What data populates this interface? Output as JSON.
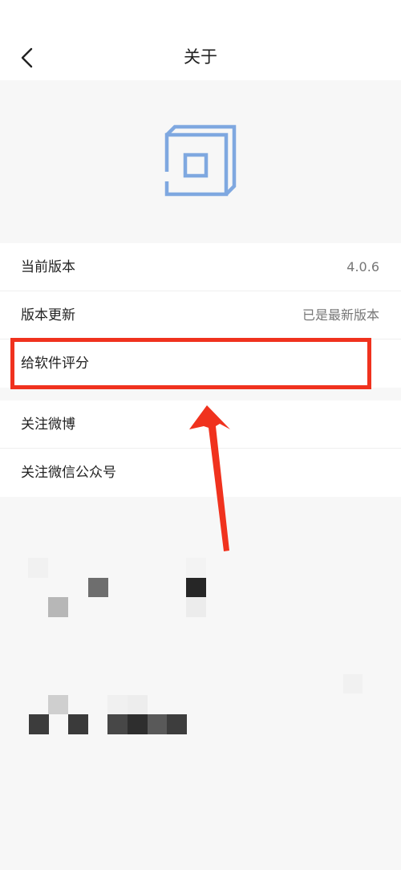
{
  "header": {
    "title": "关于",
    "back_icon": "chevron-left-icon"
  },
  "logo": {
    "icon": "app-logo-icon",
    "color": "#7fa8e0"
  },
  "settings": {
    "rows": [
      {
        "label": "当前版本",
        "value": "4.0.6"
      },
      {
        "label": "版本更新",
        "value": "已是最新版本"
      },
      {
        "label": "给软件评分",
        "value": ""
      },
      {
        "label": "关注微博",
        "value": ""
      },
      {
        "label": "关注微信公众号",
        "value": ""
      }
    ]
  },
  "annotation": {
    "highlight_color": "#f0321e",
    "highlighted_row": "给软件评分"
  }
}
